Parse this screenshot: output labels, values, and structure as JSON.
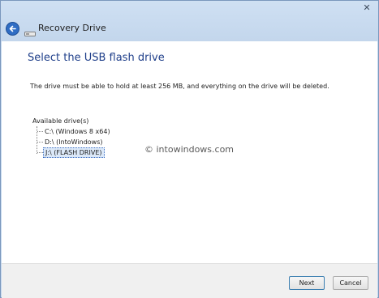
{
  "window": {
    "title": "Recovery Drive",
    "close_glyph": "✕"
  },
  "content": {
    "heading": "Select the USB flash drive",
    "instruction": "The drive must be able to hold at least 256 MB, and everything on the drive will be deleted.",
    "tree": {
      "root_label": "Available drive(s)",
      "items": [
        {
          "label": "C:\\ (Windows 8 x64)",
          "selected": false
        },
        {
          "label": "D:\\ (IntoWindows)",
          "selected": false
        },
        {
          "label": "J:\\ (FLASH DRIVE)",
          "selected": true
        }
      ]
    }
  },
  "watermark": "© intowindows.com",
  "footer": {
    "next_label": "Next",
    "cancel_label": "Cancel"
  },
  "icons": {
    "back": "back-arrow-icon",
    "drive": "drive-icon",
    "close": "close-icon"
  },
  "colors": {
    "titlebar": "#c5d8ee",
    "heading": "#1f3f8a",
    "back_button": "#2f6dc4"
  }
}
